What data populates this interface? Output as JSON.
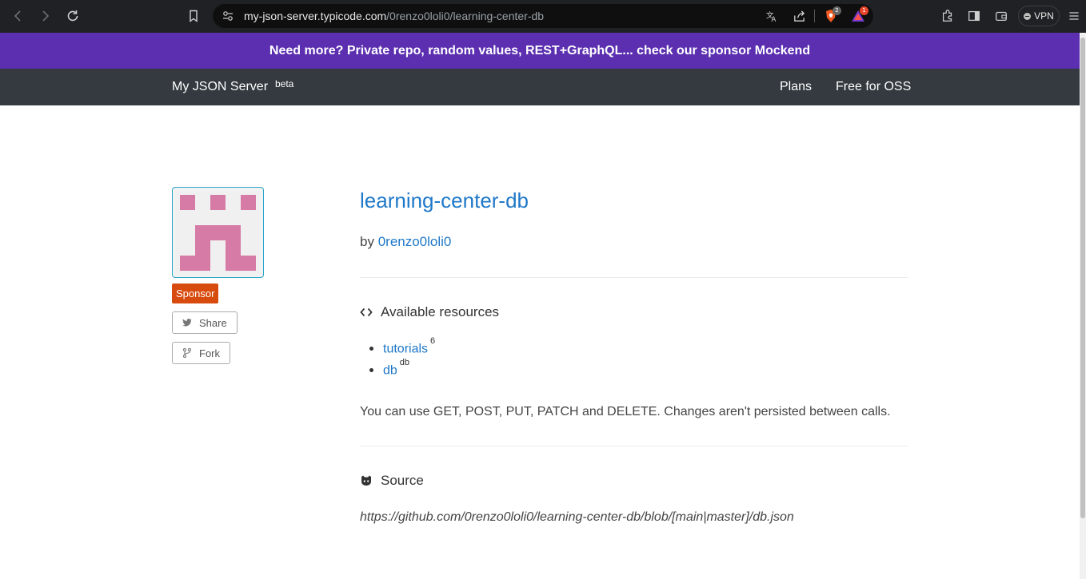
{
  "browser": {
    "url_host": "my-json-server.typicode.com",
    "url_path": "/0renzo0loli0/learning-center-db",
    "shields_count": "2",
    "rewards_count": "1",
    "vpn_label": "VPN"
  },
  "banner": {
    "text": "Need more? Private repo, random values, REST+GraphQL... check our sponsor Mockend"
  },
  "navbar": {
    "brand": "My JSON Server",
    "beta": "beta",
    "links": [
      "Plans",
      "Free for OSS"
    ]
  },
  "sidebar": {
    "sponsor": "Sponsor",
    "share": "Share",
    "fork": "Fork",
    "avatar_color": "#d67aa6"
  },
  "repo": {
    "name": "learning-center-db",
    "by": "by",
    "owner": "0renzo0loli0"
  },
  "resources": {
    "heading": "Available resources",
    "items": [
      {
        "name": "tutorials",
        "count": "6"
      },
      {
        "name": "db",
        "count": "db"
      }
    ],
    "note": "You can use GET, POST, PUT, PATCH and DELETE. Changes aren't persisted between calls."
  },
  "source": {
    "heading": "Source",
    "url": "https://github.com/0renzo0loli0/learning-center-db/blob/[main|master]/db.json"
  },
  "colors": {
    "accent": "#1f78c8",
    "banner": "#5b2fb0",
    "navbar": "#343a40",
    "sponsor": "#d84b0f"
  }
}
